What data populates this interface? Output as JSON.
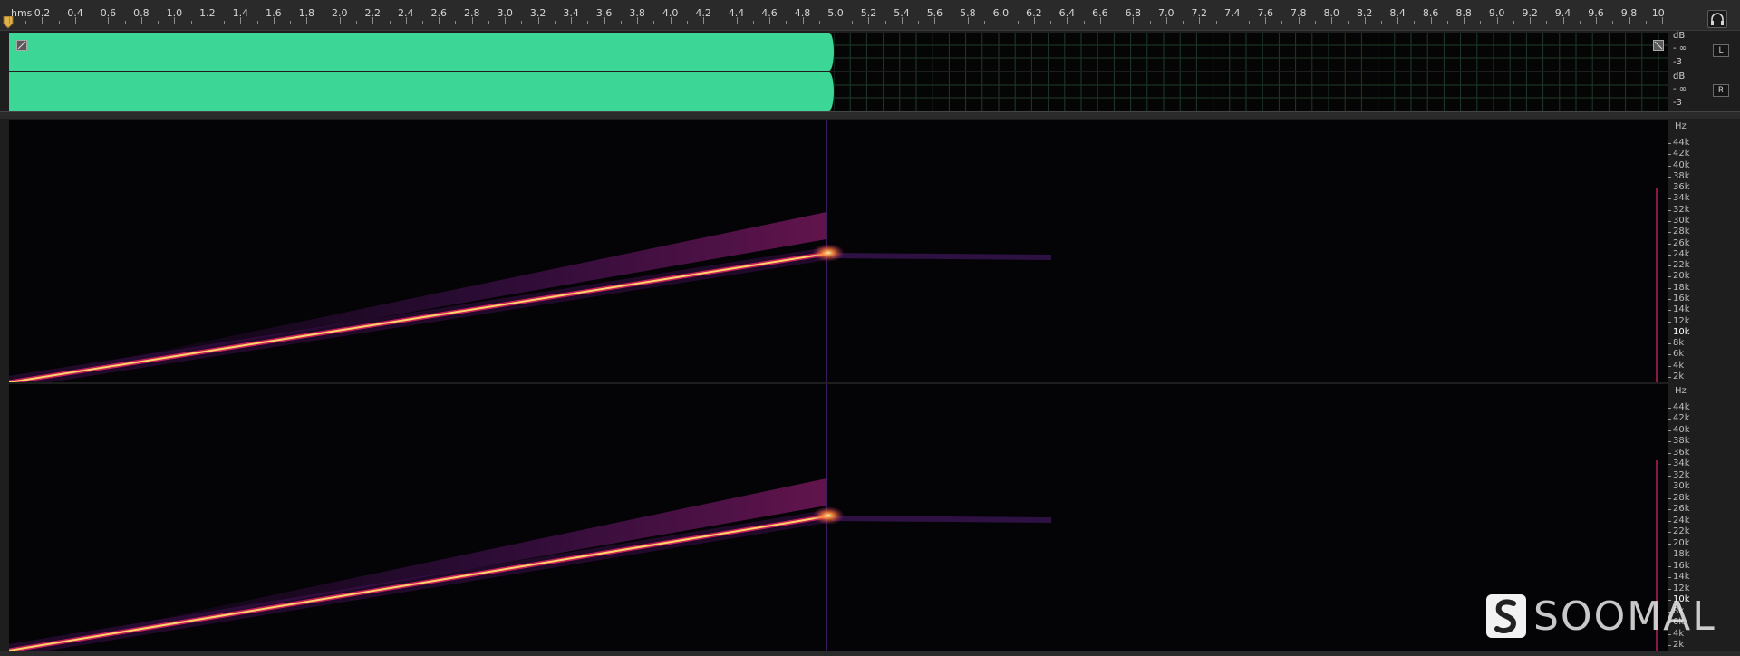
{
  "ruler": {
    "unit_label": "hms",
    "labels": [
      "0.2",
      "0.4",
      "0.6",
      "0.8",
      "1.0",
      "1.2",
      "1.4",
      "1.6",
      "1.8",
      "2.0",
      "2.2",
      "2.4",
      "2.6",
      "2.8",
      "3.0",
      "3.2",
      "3.4",
      "3.6",
      "3.8",
      "4.0",
      "4.2",
      "4.4",
      "4.6",
      "4.8",
      "5.0",
      "5.2",
      "5.4",
      "5.6",
      "5.8",
      "6.0",
      "6.2",
      "6.4",
      "6.6",
      "6.8",
      "7.0",
      "7.2",
      "7.4",
      "7.6",
      "7.8",
      "8.0",
      "8.2",
      "8.4",
      "8.6",
      "8.8",
      "9.0",
      "9.2",
      "9.4",
      "9.6",
      "9.8",
      "10"
    ]
  },
  "controls": {
    "headphone_icon": "headphones-icon"
  },
  "waveform": {
    "color": "#3cd696",
    "channels": [
      {
        "button": "L",
        "db_label": "dB",
        "db_values": [
          "- ∞",
          "-3"
        ]
      },
      {
        "button": "R",
        "db_label": "dB",
        "db_values": [
          "- ∞",
          "-3"
        ]
      }
    ]
  },
  "spectrogram": {
    "unit_label": "Hz",
    "freq_labels": [
      "44k",
      "42k",
      "40k",
      "38k",
      "36k",
      "34k",
      "32k",
      "30k",
      "28k",
      "26k",
      "24k",
      "22k",
      "20k",
      "18k",
      "16k",
      "14k",
      "12k",
      "10k",
      "8k",
      "6k",
      "4k",
      "2k"
    ]
  },
  "watermark": {
    "brand": "SOOMAL"
  }
}
